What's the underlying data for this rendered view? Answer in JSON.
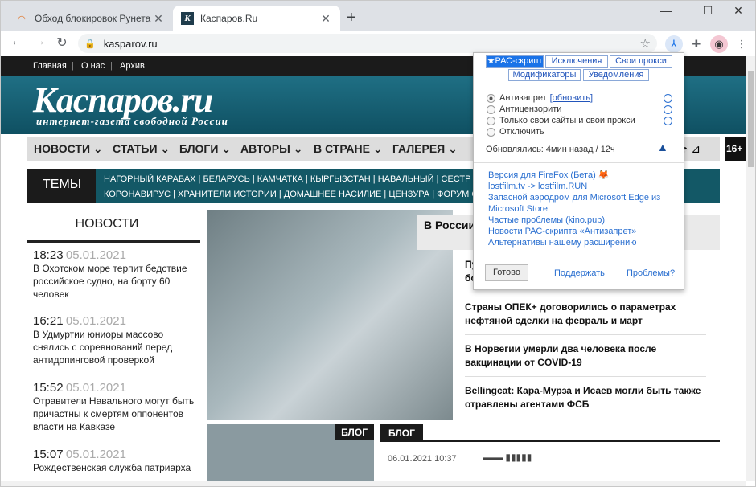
{
  "tabs": [
    {
      "title": "Обход блокировок Рунета - Ин",
      "icon": "rainbow-icon"
    },
    {
      "title": "Каспаров.Ru",
      "icon": "kasparov-k-icon"
    }
  ],
  "address": {
    "url": "kasparov.ru"
  },
  "site": {
    "topnav": [
      "Главная",
      "|",
      "О нас",
      "|",
      "Архив"
    ],
    "logo": "Каспаров.ru",
    "logo_sub": "интернет-газета свободной России",
    "menu": [
      "НОВОСТИ ⌄",
      "СТАТЬИ ⌄",
      "БЛОГИ ⌄",
      "АВТОРЫ ⌄",
      "В СТРАНЕ ⌄",
      "ГАЛЕРЕЯ ⌄"
    ],
    "age": "16+",
    "themes_label": "ТЕМЫ",
    "themes_line1": "НАГОРНЫЙ КАРАБАХ  |  БЕЛАРУСЬ  |  КАМЧАТКА  |  КЫРГЫЗСТАН  |  НАВАЛЬНЫЙ  |  СЕСТР",
    "themes_line2": "КОРОНАВИРУС  |  ХРАНИТЕЛИ ИСТОРИИ  |  ДОМАШНЕЕ НАСИЛИЕ  |  ЦЕНЗУРА  |  ФОРУМ С",
    "news_heading": "НОВОСТИ",
    "news": [
      {
        "time": "18:23",
        "date": "05.01.2021",
        "text": "В Охотском море терпит бедствие российское судно, на борту 60 человек"
      },
      {
        "time": "16:21",
        "date": "05.01.2021",
        "text": "В Удмуртии юниоры массово снялись с соревнований перед антидопинговой проверкой"
      },
      {
        "time": "15:52",
        "date": "05.01.2021",
        "text": "Отравители Навального могут быть причастны к смертям оппонентов власти на Кавказе"
      },
      {
        "time": "15:07",
        "date": "05.01.2021",
        "text": "Рождественская служба патриарха"
      }
    ],
    "featured_title": "В России коронави",
    "headlines": [
      "Пу бо",
      "Страны ОПЕК+ договорились о параметрах нефтяной сделки на февраль и март",
      "В Норвегии умерли два человека после вакцинации от COVID-19",
      "Bellingcat: Кара-Мурза и Исаев могли быть также отравлены агентами ФСБ"
    ],
    "blog_tag": "БЛОГ",
    "blog_date": "06.01.2021 10:37"
  },
  "popup": {
    "tabs": [
      "★РАС-скрипт",
      "Исключения",
      "Свои прокси",
      "Модификаторы",
      "Уведомления"
    ],
    "modes": [
      {
        "label": "Антизапрет",
        "extra": "[обновить]",
        "selected": true
      },
      {
        "label": "Антицензорити",
        "extra": "",
        "selected": false
      },
      {
        "label": "Только свои сайты и свои прокси",
        "extra": "",
        "selected": false
      },
      {
        "label": "Отключить",
        "extra": "",
        "selected": false
      }
    ],
    "updated": "Обновлялись: 4мин назад / 12ч",
    "links": [
      "Версия для FireFox (Бета) 🦊",
      "lostfilm.tv -> lostfilm.RUN",
      "Запасной аэродром для Microsoft Edge из Microsoft Store",
      "Частые проблемы (kino.pub)",
      "Новости РАС-скрипта «Антизапрет»",
      "Альтернативы нашему расширению"
    ],
    "done": "Готово",
    "support": "Поддержать",
    "problems": "Проблемы?"
  }
}
